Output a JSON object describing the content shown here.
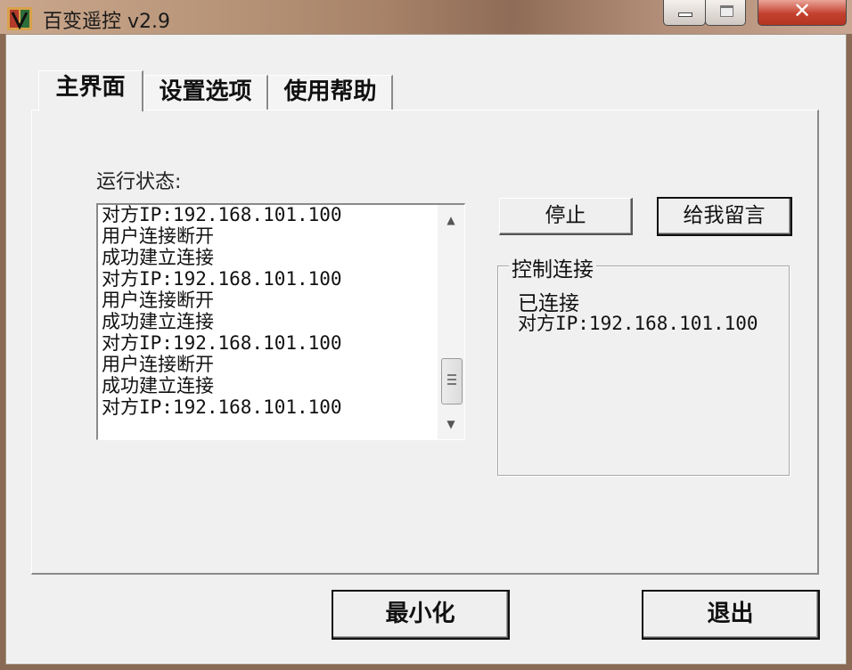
{
  "window": {
    "title": "百变遥控 v2.9",
    "close_glyph": "✕"
  },
  "tabs": [
    {
      "label": "主界面",
      "active": true
    },
    {
      "label": "设置选项",
      "active": false
    },
    {
      "label": "使用帮助",
      "active": false
    }
  ],
  "main": {
    "status_label": "运行状态:",
    "log": [
      "对方IP:192.168.101.100",
      "用户连接断开",
      "成功建立连接",
      "对方IP:192.168.101.100",
      "用户连接断开",
      "成功建立连接",
      "对方IP:192.168.101.100",
      "用户连接断开",
      "成功建立连接",
      "对方IP:192.168.101.100"
    ],
    "stop_button": "停止",
    "message_button": "给我留言",
    "control_group": {
      "title": "控制连接",
      "state": "已连接",
      "peer": "对方IP:192.168.101.100"
    }
  },
  "footer": {
    "minimize_button": "最小化",
    "exit_button": "退出"
  },
  "colors": {
    "window_bg": "#f0f0f0",
    "close_button": "#c4402e",
    "title_bar": "#b89579"
  }
}
